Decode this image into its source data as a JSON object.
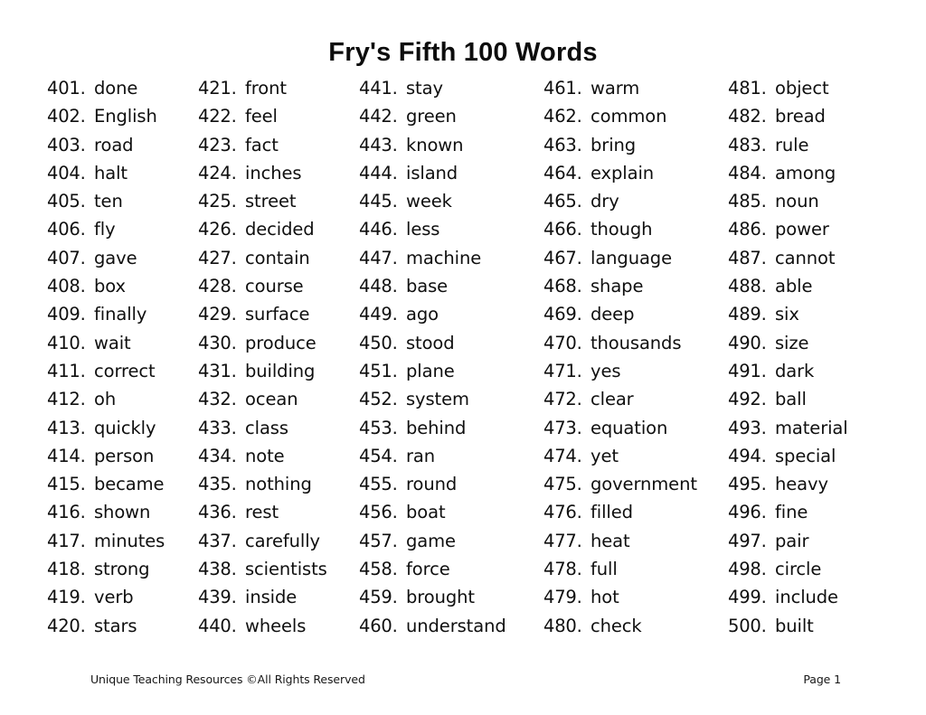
{
  "document": {
    "title": "Fry's Fifth 100 Words",
    "background_color": "#ffffff",
    "text_color": "#0f0f0f"
  },
  "footer": {
    "left_text": "Unique Teaching Resources ©All Rights Reserved",
    "right_text": "Page 1"
  },
  "word_list": {
    "columns": [
      {
        "id": "column-1",
        "entries": [
          {
            "number": "401.",
            "word": "done"
          },
          {
            "number": "402.",
            "word": "English"
          },
          {
            "number": "403.",
            "word": "road"
          },
          {
            "number": "404.",
            "word": "halt"
          },
          {
            "number": "405.",
            "word": "ten"
          },
          {
            "number": "406.",
            "word": "fly"
          },
          {
            "number": "407.",
            "word": "gave"
          },
          {
            "number": "408.",
            "word": "box"
          },
          {
            "number": "409.",
            "word": "finally"
          },
          {
            "number": "410.",
            "word": "wait"
          },
          {
            "number": "411.",
            "word": "correct"
          },
          {
            "number": "412.",
            "word": "oh"
          },
          {
            "number": "413.",
            "word": "quickly"
          },
          {
            "number": "414.",
            "word": "person"
          },
          {
            "number": "415.",
            "word": "became"
          },
          {
            "number": "416.",
            "word": "shown"
          },
          {
            "number": "417.",
            "word": "minutes"
          },
          {
            "number": "418.",
            "word": "strong"
          },
          {
            "number": "419.",
            "word": "verb"
          },
          {
            "number": "420.",
            "word": "stars"
          }
        ]
      },
      {
        "id": "column-2",
        "entries": [
          {
            "number": "421.",
            "word": "front"
          },
          {
            "number": "422.",
            "word": "feel"
          },
          {
            "number": "423.",
            "word": "fact"
          },
          {
            "number": "424.",
            "word": "inches"
          },
          {
            "number": "425.",
            "word": "street"
          },
          {
            "number": "426.",
            "word": "decided"
          },
          {
            "number": "427.",
            "word": "contain"
          },
          {
            "number": "428.",
            "word": "course"
          },
          {
            "number": "429.",
            "word": "surface"
          },
          {
            "number": "430.",
            "word": "produce"
          },
          {
            "number": "431.",
            "word": "building"
          },
          {
            "number": "432.",
            "word": "ocean"
          },
          {
            "number": "433.",
            "word": "class"
          },
          {
            "number": "434.",
            "word": "note"
          },
          {
            "number": "435.",
            "word": "nothing"
          },
          {
            "number": "436.",
            "word": "rest"
          },
          {
            "number": "437.",
            "word": "carefully"
          },
          {
            "number": "438.",
            "word": "scientists"
          },
          {
            "number": "439.",
            "word": "inside"
          },
          {
            "number": "440.",
            "word": "wheels"
          }
        ]
      },
      {
        "id": "column-3",
        "entries": [
          {
            "number": "441.",
            "word": "stay"
          },
          {
            "number": "442.",
            "word": "green"
          },
          {
            "number": "443.",
            "word": "known"
          },
          {
            "number": "444.",
            "word": "island"
          },
          {
            "number": "445.",
            "word": "week"
          },
          {
            "number": "446.",
            "word": "less"
          },
          {
            "number": "447.",
            "word": "machine"
          },
          {
            "number": "448.",
            "word": "base"
          },
          {
            "number": "449.",
            "word": "ago"
          },
          {
            "number": "450.",
            "word": "stood"
          },
          {
            "number": "451.",
            "word": "plane"
          },
          {
            "number": "452.",
            "word": "system"
          },
          {
            "number": "453.",
            "word": "behind"
          },
          {
            "number": "454.",
            "word": "ran"
          },
          {
            "number": "455.",
            "word": "round"
          },
          {
            "number": "456.",
            "word": "boat"
          },
          {
            "number": "457.",
            "word": "game"
          },
          {
            "number": "458.",
            "word": "force"
          },
          {
            "number": "459.",
            "word": "brought"
          },
          {
            "number": "460.",
            "word": "understand"
          }
        ]
      },
      {
        "id": "column-4",
        "entries": [
          {
            "number": "461.",
            "word": "warm"
          },
          {
            "number": "462.",
            "word": "common"
          },
          {
            "number": "463.",
            "word": "bring"
          },
          {
            "number": "464.",
            "word": "explain"
          },
          {
            "number": "465.",
            "word": "dry"
          },
          {
            "number": "466.",
            "word": "though"
          },
          {
            "number": "467.",
            "word": "language"
          },
          {
            "number": "468.",
            "word": "shape"
          },
          {
            "number": "469.",
            "word": "deep"
          },
          {
            "number": "470.",
            "word": "thousands"
          },
          {
            "number": "471.",
            "word": "yes"
          },
          {
            "number": "472.",
            "word": "clear"
          },
          {
            "number": "473.",
            "word": "equation"
          },
          {
            "number": "474.",
            "word": "yet"
          },
          {
            "number": "475.",
            "word": "government"
          },
          {
            "number": "476.",
            "word": "filled"
          },
          {
            "number": "477.",
            "word": "heat"
          },
          {
            "number": "478.",
            "word": "full"
          },
          {
            "number": "479.",
            "word": "hot"
          },
          {
            "number": "480.",
            "word": "check"
          }
        ]
      },
      {
        "id": "column-5",
        "entries": [
          {
            "number": "481.",
            "word": "object"
          },
          {
            "number": "482.",
            "word": "bread"
          },
          {
            "number": "483.",
            "word": "rule"
          },
          {
            "number": "484.",
            "word": "among"
          },
          {
            "number": "485.",
            "word": "noun"
          },
          {
            "number": "486.",
            "word": "power"
          },
          {
            "number": "487.",
            "word": "cannot"
          },
          {
            "number": "488.",
            "word": "able"
          },
          {
            "number": "489.",
            "word": "six"
          },
          {
            "number": "490.",
            "word": "size"
          },
          {
            "number": "491.",
            "word": "dark"
          },
          {
            "number": "492.",
            "word": "ball"
          },
          {
            "number": "493.",
            "word": "material"
          },
          {
            "number": "494.",
            "word": "special"
          },
          {
            "number": "495.",
            "word": "heavy"
          },
          {
            "number": "496.",
            "word": "fine"
          },
          {
            "number": "497.",
            "word": "pair"
          },
          {
            "number": "498.",
            "word": "circle"
          },
          {
            "number": "499.",
            "word": "include"
          },
          {
            "number": "500.",
            "word": "built"
          }
        ]
      }
    ]
  }
}
